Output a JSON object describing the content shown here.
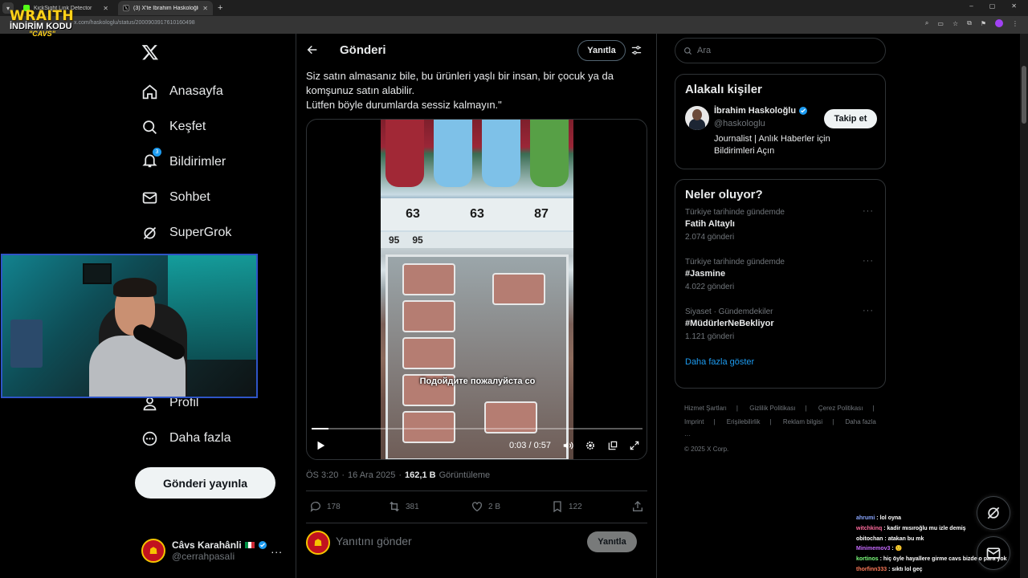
{
  "browser": {
    "tabs": [
      {
        "title": "KickSight Link Detector",
        "active": false
      },
      {
        "title": "(3) X'te İbrahim Haskoloğlu: \"Sı...",
        "active": true
      }
    ],
    "url": "x.com/haskologlu/status/2000903917610160498",
    "overlay_logo": {
      "line1": "WRAITH",
      "line2": "İNDİRİM KODU",
      "line3": "\"CAVS\""
    }
  },
  "nav": {
    "items": [
      {
        "label": "Anasayfa",
        "icon": "home-icon"
      },
      {
        "label": "Keşfet",
        "icon": "search-icon"
      },
      {
        "label": "Bildirimler",
        "icon": "bell-icon",
        "badge": "3"
      },
      {
        "label": "Sohbet",
        "icon": "mail-icon"
      },
      {
        "label": "SuperGrok",
        "icon": "grok-icon"
      }
    ],
    "lower_items": [
      {
        "label": "Profil",
        "icon": "person-icon"
      },
      {
        "label": "Daha fazla",
        "icon": "more-circle-icon"
      }
    ],
    "post_button": "Gönderi yayınla",
    "account": {
      "name": "Câvs Karahânli",
      "handle": "@cerrahpasaIi",
      "more": "..."
    }
  },
  "post": {
    "header_title": "Gönderi",
    "reply_pill": "Yanıtla",
    "text_lines": [
      "Siz satın almasanız bile, bu ürünleri yaşlı bir insan, bir çocuk ya da",
      "komşunuz satın alabilir.",
      "Lütfen böyle durumlarda sessiz kalmayın.\""
    ],
    "video": {
      "subtitle": "Подойдите пожалуйста со",
      "time": "0:03 / 0:57",
      "progress": 0.05,
      "prices": [
        "63",
        "63",
        "87"
      ],
      "prices_row2": [
        "95",
        "95"
      ]
    },
    "meta": {
      "time": "ÖS 3:20",
      "sep": "·",
      "date": "16 Ara 2025",
      "views": "162,1 B",
      "views_label": "Görüntüleme"
    },
    "actions": {
      "replies": "178",
      "reposts": "381",
      "likes": "2 B",
      "bookmarks": "122"
    },
    "reply_placeholder": "Yanıtını gönder",
    "reply_button": "Yanıtla"
  },
  "sidebar": {
    "search_placeholder": "Ara",
    "related": {
      "title": "Alakalı kişiler",
      "name": "İbrahim Haskoloğlu",
      "handle": "@haskologlu",
      "bio": "Journalist | Anlık Haberler için Bildirimleri Açın",
      "follow": "Takip et"
    },
    "trends": {
      "title": "Neler oluyor?",
      "items": [
        {
          "context": "Türkiye tarihinde gündemde",
          "name": "Fatih Altaylı",
          "count": "2.074 gönderi"
        },
        {
          "context": "Türkiye tarihinde gündemde",
          "name": "#Jasmine",
          "count": "4.022 gönderi"
        },
        {
          "context": "Siyaset · Gündemdekiler",
          "name": "#MüdürlerNeBekliyor",
          "count": "1.121 gönderi"
        }
      ],
      "show_more": "Daha fazla göster"
    },
    "footer": [
      "Hizmet Şartları",
      "|",
      "Gizlilik Politikası",
      "|",
      "Çerez Politikası",
      "|",
      "Imprint",
      "|",
      "Erişilebilirlik",
      "|",
      "Reklam bilgisi",
      "|",
      "Daha fazla ···",
      "© 2025 X Corp."
    ]
  },
  "chat": [
    {
      "user": "ahrumi",
      "color": "#8aa6ff",
      "msg": "lol oyna"
    },
    {
      "user": "witchkinq",
      "color": "#ff6b9d",
      "msg": "kadir mısıroğlu mu izle demiş"
    },
    {
      "user": "obitochan",
      "color": "#ffffff",
      "msg": "atakan bu mk"
    },
    {
      "user": "Minimemov3",
      "color": "#c76bff",
      "msg": "🙂"
    },
    {
      "user": "kortinos",
      "color": "#7dff7d",
      "msg": "hiç öyle hayallere girme cavs bizde o para yok"
    },
    {
      "user": "thorfinn333",
      "color": "#ff7a59",
      "msg": "sıktı lol geç"
    }
  ]
}
